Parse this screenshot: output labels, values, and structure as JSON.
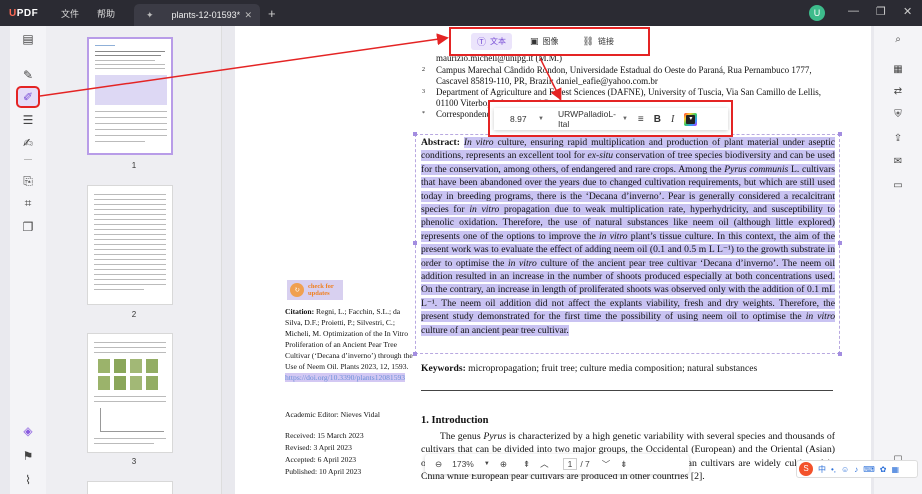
{
  "app": {
    "logo": "UPDF",
    "menu": [
      "文件",
      "帮助"
    ]
  },
  "tab": {
    "title": "plants-12-01593*",
    "close": "✕",
    "add": "+"
  },
  "user": {
    "avatar_letter": "U"
  },
  "window_controls": {
    "minimize": "—",
    "restore": "❐",
    "close": "✕"
  },
  "thumbnails": [
    {
      "page": "1"
    },
    {
      "page": "2"
    },
    {
      "page": "3"
    }
  ],
  "edit_modes": [
    {
      "label": "文本",
      "icon": "text-icon"
    },
    {
      "label": "图像",
      "icon": "image-icon"
    },
    {
      "label": "链接",
      "icon": "link-icon"
    }
  ],
  "format_bar": {
    "font_size": "8.97",
    "font_name": "URWPalladioL-Ital",
    "bold": "B",
    "italic": "I"
  },
  "document": {
    "affiliations": [
      {
        "num": "",
        "text": "maurizio.micheli@unipg.it (M.M.)"
      },
      {
        "num": "2",
        "text": "Campus Marechal Cândido Rondon, Universidade Estadual do Oeste do Paraná, Rua Pernambuco 1777,"
      },
      {
        "num": "",
        "text": "Cascavel 85819-110, PR, Brazil; daniel_eafie@yahoo.com.br"
      },
      {
        "num": "3",
        "text": "Department of Agriculture and Forest Sciences (DAFNE), University of Tuscia, Via San Camillo de Lellis,"
      },
      {
        "num": "",
        "text": "01100 Viterbo, Italy; silvestri@unitus.it"
      },
      {
        "num": "*",
        "text": "Correspondence: lu"
      }
    ],
    "abstract_label": "Abstract:",
    "abstract_parts": [
      {
        "t": "In vitro",
        "i": true
      },
      {
        "t": " culture, ensuring rapid multiplication and production of plant material under aseptic conditions, represents an excellent tool for ",
        "i": false
      },
      {
        "t": "ex-situ",
        "i": true
      },
      {
        "t": " conservation of tree species biodiversity and can be used for the conservation, among others, of endangered and rare crops.  Among the ",
        "i": false
      },
      {
        "t": "Pyrus communis",
        "i": true
      },
      {
        "t": " L. cultivars that have been abandoned over the years due to changed cultivation requirements, but which are still used today in breeding programs, there is the ‘Decana d’inverno’. Pear is generally considered a recalcitrant species for ",
        "i": false
      },
      {
        "t": "in vitro",
        "i": true
      },
      {
        "t": " propagation due to weak multiplication rate, hyperhydricity, and susceptibility to phenolic oxidation. Therefore, the use of natural substances like neem oil (although little explored) represents one of the options to improve the ",
        "i": false
      },
      {
        "t": "in vitro",
        "i": true
      },
      {
        "t": " plant’s tissue culture. In this context, the aim of the present work was to evaluate the effect of adding neem oil (0.1 and 0.5 m L L⁻¹) to the growth substrate in order to optimise the ",
        "i": false
      },
      {
        "t": "in vitro",
        "i": true
      },
      {
        "t": " culture of the ancient pear tree cultivar ‘Decana d’inverno’. The neem oil addition resulted in an increase in the number of shoots produced especially at both concentrations used. On the contrary, an increase in length of proliferated shoots was observed only with the addition of 0.1 mL L⁻¹. The neem oil addition did not affect the explants viability, fresh and dry weights. Therefore, the present study demonstrated for the first time the possibility of using neem oil to optimise the ",
        "i": false
      },
      {
        "t": "in vitro",
        "i": true
      },
      {
        "t": " culture of an ancient pear tree cultivar.",
        "i": false
      }
    ],
    "keywords_label": "Keywords:",
    "keywords": " micropropagation; fruit tree; culture media composition; natural substances",
    "intro_heading": "1. Introduction",
    "intro_text_a": "The genus ",
    "intro_text_b": "Pyrus",
    "intro_text_c": " is characterized by a high genetic variability with several species and thousands of cultivars that can be divided into two major groups, the Occidental (European) and the Oriental (Asian) ones. Out of the 20 million tons per year of pears produced, Asian cultivars are widely cultivated in China while European pear cultivars are produced in other countries [2].",
    "badge_line1": "check for",
    "badge_line2": "updates",
    "citation_label": "Citation:",
    "citation": " Regni, L.; Facchin, S.L.; da Silva, D.F.; Proietti, P.; Silvestri, C.; Micheli, M. Optimization of the In Vitro Proliferation of an Ancient Pear Tree Cultivar (‘Decana d’inverno’) through the Use of Neem Oil. Plants 2023, 12, 1593.",
    "citation_link": "https://doi.org/10.3390/plants12081593",
    "editor": "Academic Editor: Nieves Vidal",
    "dates": [
      "Received: 15 March 2023",
      "Revised: 3 April 2023",
      "Accepted: 6 April 2023",
      "Published: 10 April 2023"
    ]
  },
  "page_nav": {
    "zoom": "173%",
    "current_page": "1",
    "total": "/ 7"
  },
  "ime": {
    "label": "中"
  }
}
